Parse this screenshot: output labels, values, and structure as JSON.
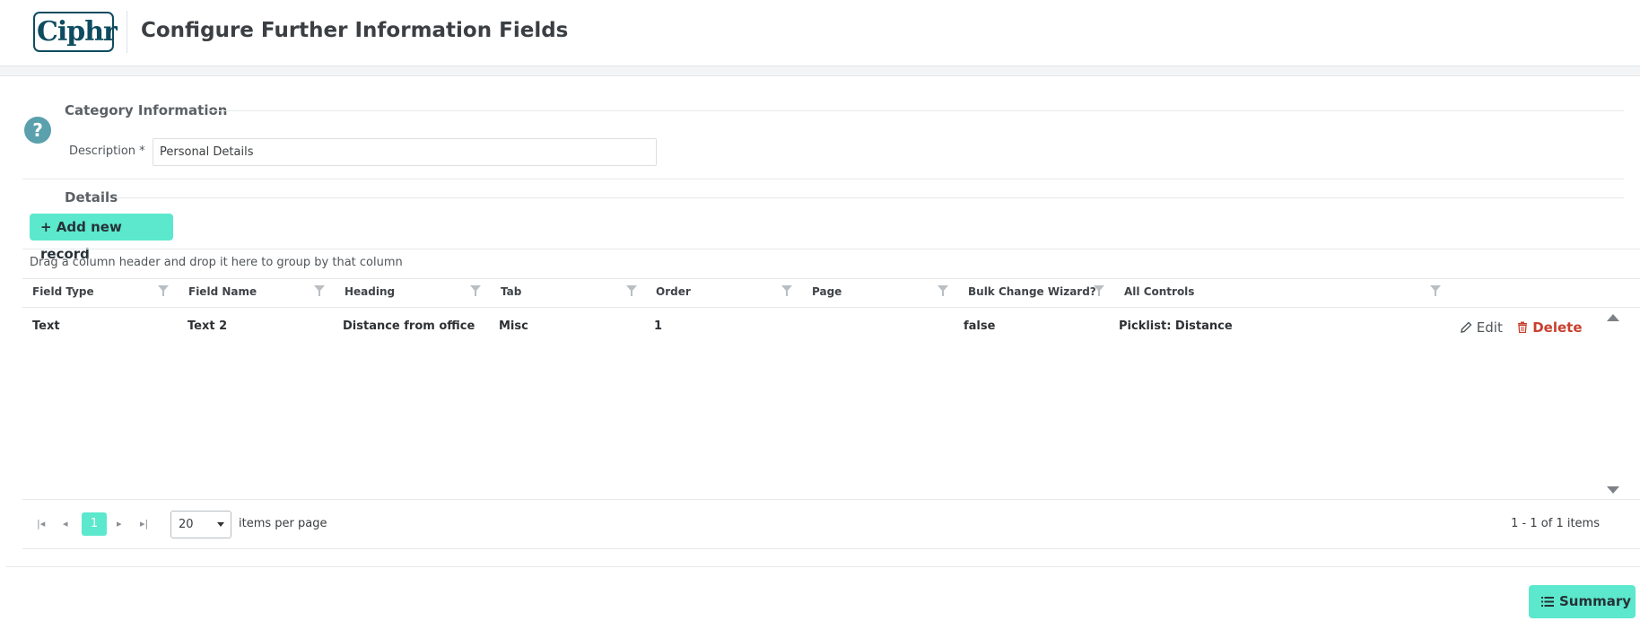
{
  "header": {
    "logo_text": "Ciphr",
    "title": "Configure Further Information Fields"
  },
  "category": {
    "section_title": "Category Information",
    "help_icon": "question-icon",
    "description_label": "Description *",
    "description_value": "Personal Details"
  },
  "details": {
    "section_title": "Details",
    "add_button": "+ Add new record",
    "group_hint": "Drag a column header and drop it here to group by that column"
  },
  "grid": {
    "columns": [
      "Field Type",
      "Field Name",
      "Heading",
      "Tab",
      "Order",
      "Page",
      "Bulk Change Wizard?",
      "All Controls"
    ],
    "rows": [
      {
        "field_type": "Text",
        "field_name": "Text 2",
        "heading": "Distance from office",
        "tab": "Misc",
        "order": "1",
        "page": "",
        "bulk_change_wizard": "false",
        "all_controls": "Picklist: Distance"
      }
    ],
    "edit_label": "Edit",
    "delete_label": "Delete"
  },
  "pager": {
    "current_page": "1",
    "page_size": "20",
    "per_page_label": "items per page",
    "items_info": "1 - 1 of 1 items"
  },
  "footer": {
    "summary_button": "Summary"
  },
  "colors": {
    "accent": "#5ce8cc",
    "brand": "#0e4c60",
    "delete": "#c9402e",
    "help": "#5aa0ad"
  }
}
